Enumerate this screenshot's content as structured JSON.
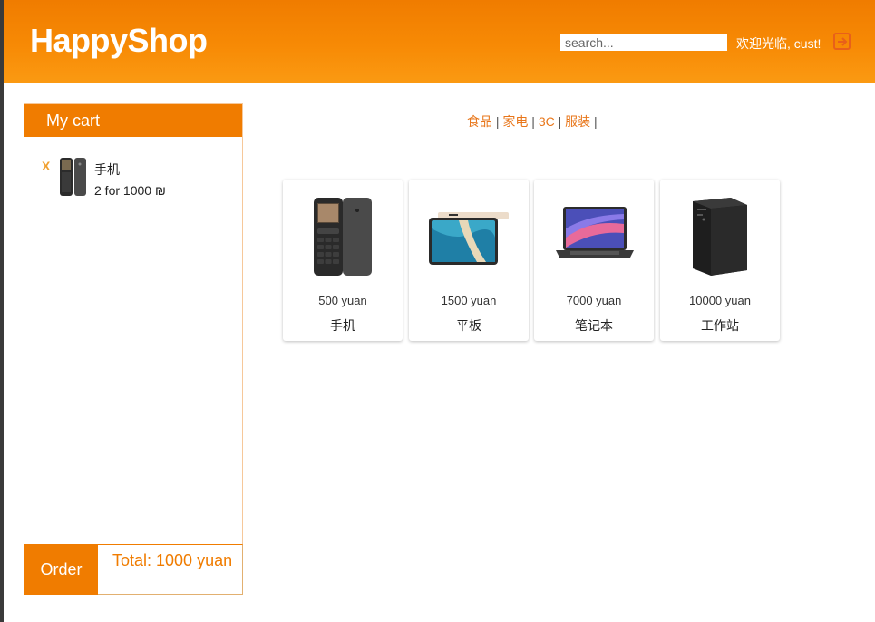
{
  "header": {
    "logo": "HappyShop",
    "search_placeholder": "search...",
    "welcome": "欢迎光临, cust!"
  },
  "cart": {
    "title": "My cart",
    "items": [
      {
        "remove": "X",
        "name": "手机",
        "quantity_text": "2 for 1000 ₪"
      }
    ],
    "order_label": "Order",
    "total": "Total: 1000 yuan"
  },
  "categories": [
    "食品",
    "家电",
    "3C",
    "服装"
  ],
  "products": [
    {
      "price": "500 yuan",
      "name": "手机"
    },
    {
      "price": "1500 yuan",
      "name": "平板"
    },
    {
      "price": "7000 yuan",
      "name": "笔记本"
    },
    {
      "price": "10000 yuan",
      "name": "工作站"
    }
  ],
  "colors": {
    "accent": "#f07c00",
    "link": "#e8761a"
  }
}
